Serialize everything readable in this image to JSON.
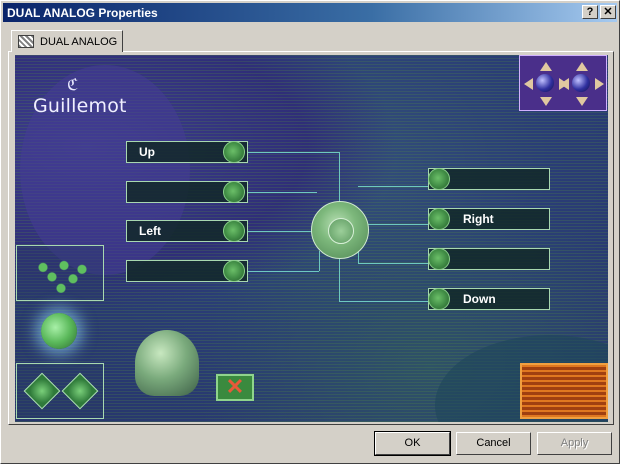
{
  "window": {
    "title": "DUAL ANALOG Properties",
    "help_label": "?",
    "close_label": "✕"
  },
  "tab": {
    "label": "DUAL ANALOG",
    "icon": "gamepad-icon"
  },
  "brand": {
    "mark": "ℭ",
    "name": "Guillemot"
  },
  "mappings": {
    "left": [
      {
        "label": "Up"
      },
      {
        "label": ""
      },
      {
        "label": "Left"
      },
      {
        "label": ""
      }
    ],
    "right": [
      {
        "label": ""
      },
      {
        "label": "Right"
      },
      {
        "label": ""
      },
      {
        "label": "Down"
      }
    ]
  },
  "buttons": {
    "ok": "OK",
    "cancel": "Cancel",
    "apply": "Apply"
  },
  "colors": {
    "title_bar": "#0a246a",
    "canvas_bg": "#2a3d76",
    "field_border": "#a8d8b0",
    "accent_green": "#3f8a44",
    "connector": "#6ec8c0"
  }
}
